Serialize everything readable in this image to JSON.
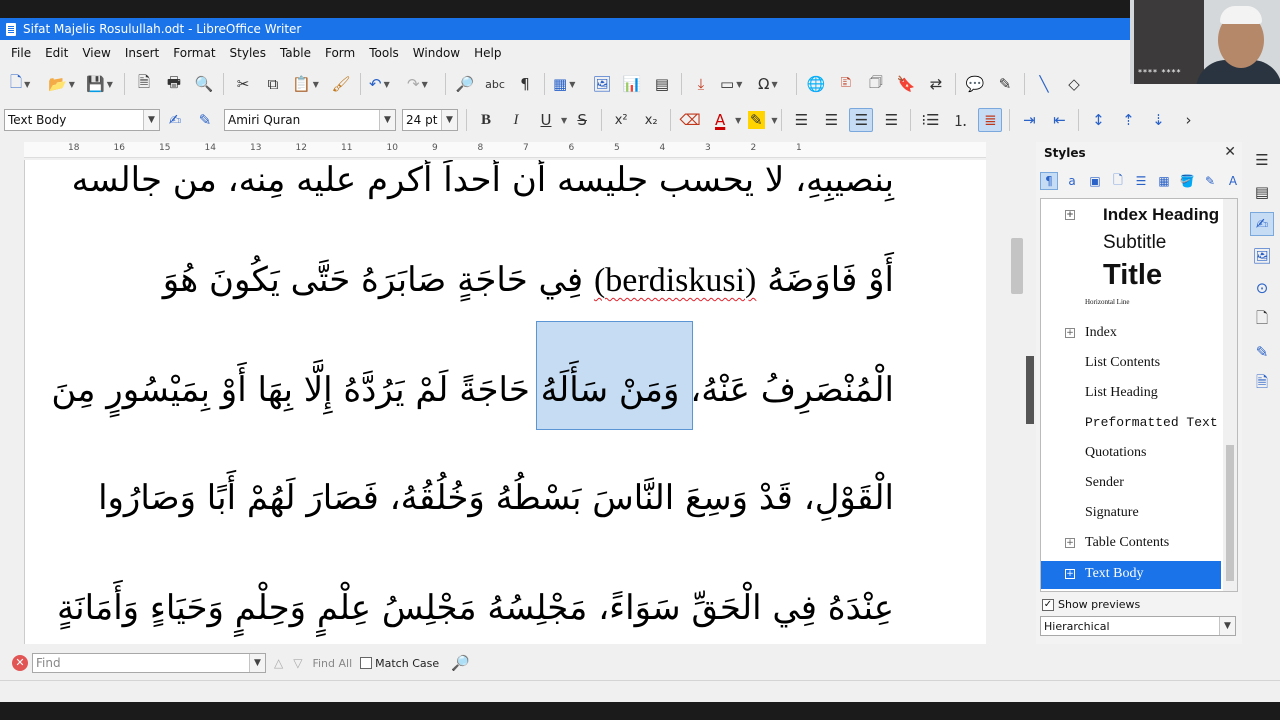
{
  "window": {
    "title": "Sifat Majelis Rosulullah.odt - LibreOffice Writer"
  },
  "menu": [
    "File",
    "Edit",
    "View",
    "Insert",
    "Format",
    "Styles",
    "Table",
    "Form",
    "Tools",
    "Window",
    "Help"
  ],
  "format_bar": {
    "paragraph_style": "Text Body",
    "font_name": "Amiri Quran",
    "font_size": "24 pt",
    "bold": "B",
    "italic": "I",
    "underline": "U",
    "strike": "S",
    "superscript": "x²",
    "subscript": "x₂",
    "active_alignment": "right"
  },
  "ruler": {
    "ticks": [
      "18",
      "16",
      "15",
      "14",
      "13",
      "12",
      "11",
      "10",
      "9",
      "8",
      "7",
      "6",
      "5",
      "4",
      "3",
      "2",
      "1"
    ]
  },
  "document": {
    "lines": [
      "بِنصيبِهِ، لا يحسب جليسه أن أحداً أكرم عليه مِنه، من جالسه",
      "أَوْ فَاوَضَهُ",
      "فِي حَاجَةٍ صَابَرَهُ حَتَّى يَكُونَ هُوَ",
      "الْمُنْصَرِفُ عَنْهُ،",
      "وَمَنْ سَأَلَهُ حَاجَةً",
      "لَمْ يَرُدَّهُ إِلَّا بِهَا أَوْ بِمَيْسُورٍ مِنَ",
      "الْقَوْلِ، قَدْ وَسِعَ النَّاسَ بَسْطُهُ وَخُلُقُهُ، فَصَارَ لَهُمْ أَبًا وَصَارُوا",
      "عِنْدَهُ فِي الْحَقِّ سَوَاءً، مَجْلِسُهُ مَجْلِسُ عِلْمٍ وَحِلْمٍ وَحَيَاءٍ وَأَمَانَةٍ"
    ],
    "latin_word": "(berdiskusi)"
  },
  "styles_panel": {
    "title": "Styles",
    "items": [
      "Index Heading",
      "Subtitle",
      "Title",
      "Horizontal Line",
      "Index",
      "List Contents",
      "List Heading",
      "Preformatted Text",
      "Quotations",
      "Sender",
      "Signature",
      "Table Contents",
      "Text Body"
    ],
    "selected": "Text Body",
    "show_previews_label": "Show previews",
    "filter": "Hierarchical"
  },
  "find_bar": {
    "placeholder": "Find",
    "find_all": "Find All",
    "match_case": "Match Case"
  },
  "webcam": {
    "caption": "**** ****"
  }
}
